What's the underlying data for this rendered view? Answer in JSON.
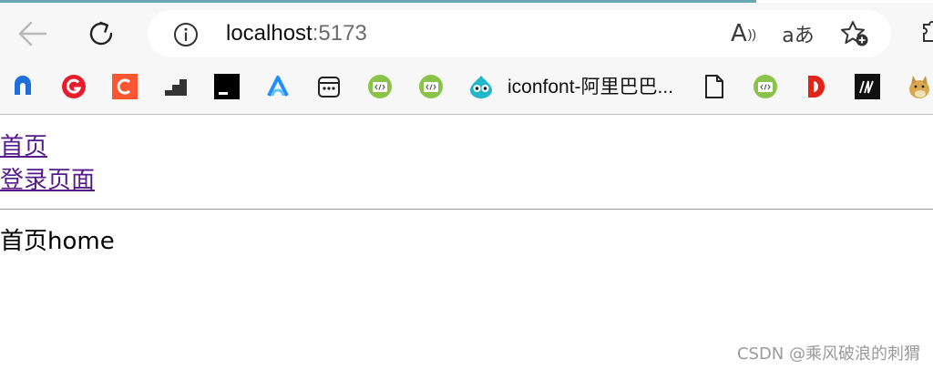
{
  "browser": {
    "url_host": "localhost",
    "url_port": ":5173",
    "read_aloud_glyph": "A",
    "translate_glyph": "aあ"
  },
  "bookmarks": [
    {
      "icon": "tencent-cloud-icon",
      "color": "#1e6fd9"
    },
    {
      "icon": "g-red-icon",
      "color": "#e81c2b"
    },
    {
      "icon": "csdn-c-icon",
      "color": "#fc5531"
    },
    {
      "icon": "stairs-icon",
      "color": "#333333"
    },
    {
      "icon": "terminal-icon",
      "color": "#000000"
    },
    {
      "icon": "arco-a-icon",
      "color": "#1f8eff"
    },
    {
      "icon": "calendar-dots-icon",
      "color": "#222222"
    },
    {
      "icon": "code-page-icon",
      "color": "#8bc34a"
    },
    {
      "icon": "code-page-icon",
      "color": "#8bc34a"
    },
    {
      "icon": "iconfont-icon",
      "color": "#1fb7c9",
      "label": "iconfont-阿里巴巴..."
    },
    {
      "icon": "file-icon",
      "color": "#222222"
    },
    {
      "icon": "code-page-icon",
      "color": "#8bc34a"
    },
    {
      "icon": "d-red-icon",
      "color": "#e1251b"
    },
    {
      "icon": "m-black-icon",
      "color": "#111111"
    },
    {
      "icon": "doge-icon",
      "color": "#d7a84d"
    }
  ],
  "page": {
    "links": [
      "首页",
      "登录页面"
    ],
    "content_text": "首页home",
    "watermark": "CSDN @乘风破浪的刺猬"
  },
  "colors": {
    "link_visited": "#551a8b",
    "toolbar_bg": "#f7f7f7",
    "tab_accent": "#6aa7b5"
  }
}
